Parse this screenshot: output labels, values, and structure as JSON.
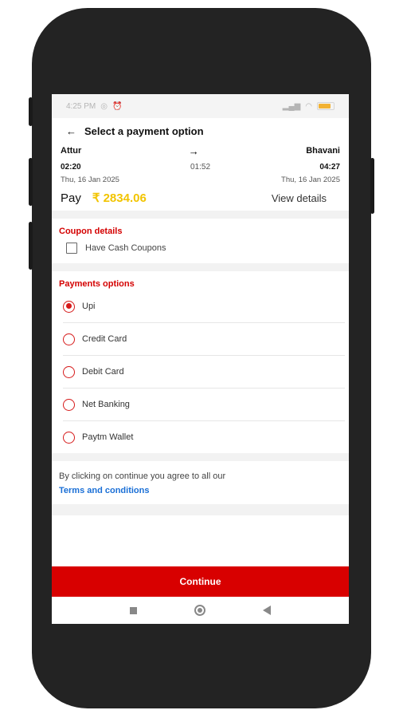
{
  "status": {
    "time": "4:25 PM",
    "battery_level": 0.75
  },
  "header": {
    "title": "Select a payment option"
  },
  "journey": {
    "from": "Attur",
    "to": "Bhavani",
    "depart_time": "02:20",
    "duration": "01:52",
    "arrive_time": "04:27",
    "depart_date": "Thu, 16 Jan 2025",
    "arrive_date": "Thu, 16 Jan 2025"
  },
  "payment": {
    "pay_label": "Pay",
    "amount": "₹ 2834.06",
    "view_details": "View details"
  },
  "coupons": {
    "title": "Coupon details",
    "checkbox_label": "Have Cash Coupons"
  },
  "options": {
    "title": "Payments options",
    "items": [
      {
        "label": "Upi",
        "selected": true
      },
      {
        "label": "Credit Card",
        "selected": false
      },
      {
        "label": "Debit Card",
        "selected": false
      },
      {
        "label": "Net Banking",
        "selected": false
      },
      {
        "label": "Paytm Wallet",
        "selected": false
      }
    ]
  },
  "terms": {
    "text": "By clicking on continue you agree to all our",
    "link": "Terms and conditions"
  },
  "footer": {
    "continue_label": "Continue"
  },
  "colors": {
    "accent": "#d80000",
    "amount": "#f2c400",
    "link": "#1a6fd6"
  }
}
